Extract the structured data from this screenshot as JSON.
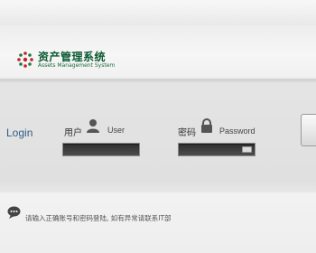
{
  "header": {
    "logo_title": "资产管理系统",
    "logo_subtitle": "Assets Management System"
  },
  "login": {
    "label": "Login",
    "username": {
      "label_cn": "用户",
      "label_en": "User",
      "value": ""
    },
    "password": {
      "label_cn": "密码",
      "label_en": "Password",
      "value": ""
    }
  },
  "footer": {
    "notice": "请输入正确账号和密码登陆, 如有异常请联系IT部"
  },
  "colors": {
    "brand_green": "#0c5a33",
    "logo_red": "#c8202a",
    "login_blue": "#2f5e86",
    "input_dark": "#3a3a3a"
  },
  "icons": {
    "logo": "logo-dots-icon",
    "user": "user-silhouette-icon",
    "password": "padlock-icon",
    "keyboard": "keyboard-icon",
    "notice": "speech-bubble-icon"
  }
}
